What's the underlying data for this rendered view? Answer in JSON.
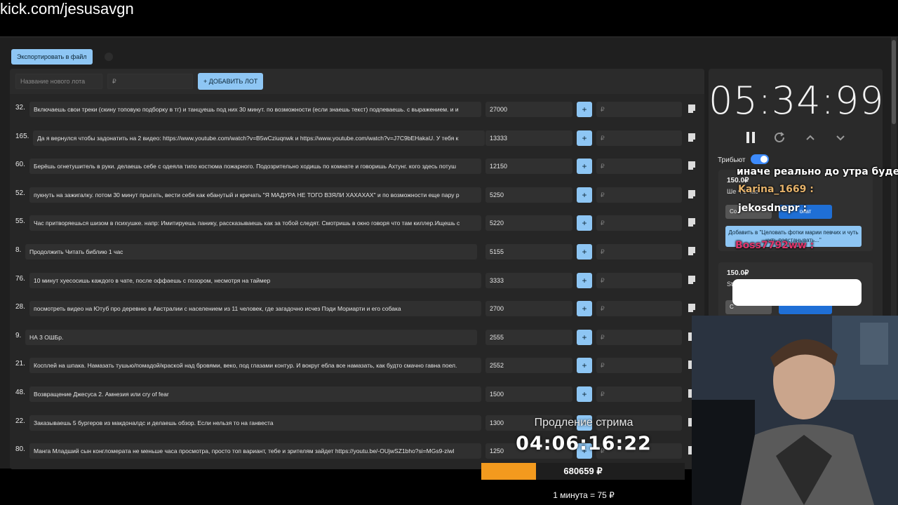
{
  "url": "kick.com/jesusavgn",
  "toolbar": {
    "export_label": "Экспортировать в файл"
  },
  "add_lot": {
    "name_placeholder": "Название нового лота",
    "price_placeholder": "₽",
    "button_label": "+ ДОБАВИТЬ ЛОТ"
  },
  "lots": [
    {
      "num": "32.",
      "title": "Включаешь свои треки (скину топовую подборку в тг) и танцуешь под них 30 минут. по возможности (если знаешь текст) подпеваешь. с выражением. и и",
      "amount": "27000",
      "plus": "+",
      "rub": "₽"
    },
    {
      "num": "165.",
      "title": "Да я вернулся чтобы задонатить на 2 видео: https://www.youtube.com/watch?v=B5wCziuqnwk и https://www.youtube.com/watch?v=J7C9bEHakaU. У тебя к",
      "amount": "13333",
      "plus": "+",
      "rub": "₽"
    },
    {
      "num": "60.",
      "title": "Берёшь огнетушитель в руки. делаешь себе с одеяла типо костюма пожарного. Подозрительно ходишь по комнате и говоришь Ахтунг. кого здесь потуш",
      "amount": "12150",
      "plus": "+",
      "rub": "₽"
    },
    {
      "num": "52.",
      "title": "пукнуть на зажигалку. потом 30 минут прыгать, вести себя как ебанутый и кричать \"Я МАДУРА НЕ ТОГО ВЗЯЛИ ХАХАХАХ\" и по возможности еще пару р",
      "amount": "5250",
      "plus": "+",
      "rub": "₽"
    },
    {
      "num": "55.",
      "title": "Час притворяешься шизом в психушке. напр: Имитируешь панику, рассказываешь как за тобой следят. Смотришь в окно говоря что там киллер.Ищешь с",
      "amount": "5220",
      "plus": "+",
      "rub": "₽"
    },
    {
      "num": "8.",
      "title": "Продолжить Читать библию 1 час",
      "amount": "5155",
      "plus": "+",
      "rub": "₽"
    },
    {
      "num": "76.",
      "title": "10 минут хуесосишь каждого в чате, после оффаешь с позором, несмотря на таймер",
      "amount": "3333",
      "plus": "+",
      "rub": "₽"
    },
    {
      "num": "28.",
      "title": "посмотреть видео на Ютуб про деревню в Австралии с населением из 11 человек, где загадочно исчез Пэди Мориарти и его собака",
      "amount": "2700",
      "plus": "+",
      "rub": "₽"
    },
    {
      "num": "9.",
      "title": "НА 3 ОШБр.",
      "amount": "2555",
      "plus": "+",
      "rub": "₽"
    },
    {
      "num": "21.",
      "title": "Косплей на шпака. Намазать тушью/помадой/краской над бровями, веко, под глазами контур. И вокруг ебла все намазать, как будто смачно гавна поел.",
      "amount": "2552",
      "plus": "+",
      "rub": "₽"
    },
    {
      "num": "48.",
      "title": "Возвращение Джесуса 2. Амнезия или cry of fear",
      "amount": "1500",
      "plus": "+",
      "rub": "₽"
    },
    {
      "num": "22.",
      "title": "Заказываешь 5 бургеров из макдоналдс и делаешь обзор. Если нельзя то на ганвеста",
      "amount": "1300",
      "plus": "+",
      "rub": "₽"
    },
    {
      "num": "80.",
      "title": "Манга Младший сын конгломерата не меньше часа просмотра, просто топ вариант, тебе и зрителям зайдет https://youtu.be/-OUjwSZ1bho?si=MGs9-ziwl",
      "amount": "1250",
      "plus": "+",
      "rub": "₽"
    }
  ],
  "timer": {
    "value": "05:34:99"
  },
  "tribute": {
    "label": "Трибьют",
    "enabled": true
  },
  "cards": [
    {
      "price": "150.0₽",
      "who": "Ше                  ч        1 час",
      "b1": "Со",
      "b2": "онат",
      "b3": "Добавить в \"Целовать фотки марии певчих и чуть чуть подстанывать...\""
    },
    {
      "price": "150.0₽",
      "who": "St",
      "b1": "С",
      "b2": "",
      "b3": ""
    }
  ],
  "chat": [
    {
      "text": "иначе реально до утра будет аук",
      "color": "#ffffff"
    },
    {
      "text": "Karina_1669 :",
      "color": "#e6b36b"
    },
    {
      "text": "jekosdnepr :",
      "color": "#ffffff"
    },
    {
      "text": "Boss7792ww :",
      "color": "#e0366b"
    }
  ],
  "stream": {
    "label": "Продление стрима",
    "time": "04:06:16:22",
    "total": "680659 ₽",
    "progress": 0.27,
    "rate": "1 минута = 75 ₽"
  },
  "colors": {
    "accent": "#8ec6f4",
    "bar": "#f39a1e",
    "panel": "#262626"
  }
}
